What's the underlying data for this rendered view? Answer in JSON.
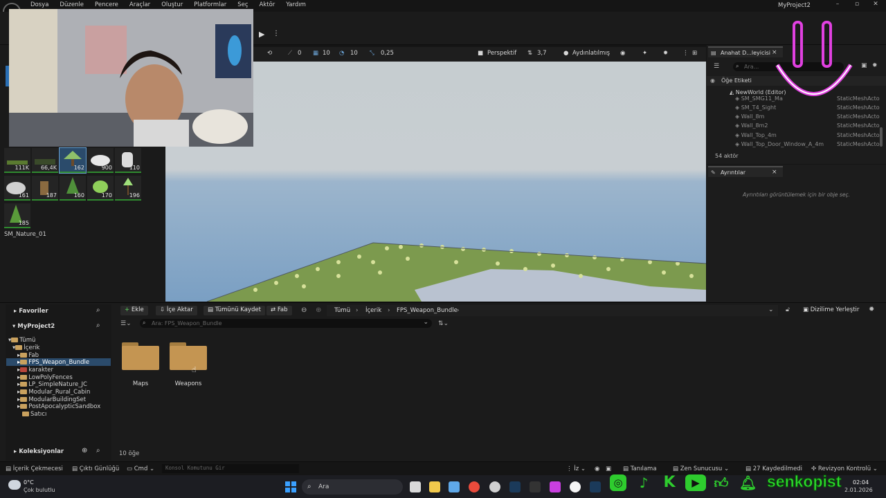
{
  "menu": [
    "Dosya",
    "Düzenle",
    "Pencere",
    "Araçlar",
    "Oluştur",
    "Platformlar",
    "Seç",
    "Aktör",
    "Yardım"
  ],
  "window": {
    "title": "MyProject2",
    "minimize": "–",
    "maximize": "▫",
    "close": "✕"
  },
  "viewport": {
    "toolbar": {
      "rotate": "0",
      "grid": "10",
      "angle": "10",
      "scale": "0,25",
      "view": "Perspektif",
      "speed": "3,7",
      "lit": "Aydınlatılmış"
    }
  },
  "place_actors": {
    "thumbs": [
      "111K",
      "66,4K",
      "162",
      "900",
      "110",
      "161",
      "187",
      "160",
      "170",
      "196",
      "185"
    ],
    "selected_label": "SM_Nature_01"
  },
  "outliner": {
    "tab": "Anahat D...leyicisi",
    "search_placeholder": "Ara...",
    "column_label": "Öğe Etiketi",
    "world": "NewWorld (Editor)",
    "rows": [
      {
        "name": "SM_SMG11_Ma",
        "type": "StaticMeshActo"
      },
      {
        "name": "SM_T4_Sight",
        "type": "StaticMeshActo"
      },
      {
        "name": "Wall_8m",
        "type": "StaticMeshActo"
      },
      {
        "name": "Wall_8m2",
        "type": "StaticMeshActo"
      },
      {
        "name": "Wall_Top_4m",
        "type": "StaticMeshActo"
      },
      {
        "name": "Wall_Top_Door_Window_A_4m",
        "type": "StaticMeshActo"
      }
    ],
    "count": "54 aktör"
  },
  "details": {
    "tab": "Ayrıntılar",
    "empty_message": "Ayrıntıları görüntülemek için bir obje seç."
  },
  "content_browser": {
    "favorites": "Favoriler",
    "project": "MyProject2",
    "tree": [
      "Tümü",
      "İçerik",
      "Fab",
      "FPS_Weapon_Bundle",
      "karakter",
      "LowPolyFences",
      "LP_SimpleNature_JC",
      "Modular_Rural_Cabin",
      "ModularBuildingSet",
      "PostApocalypticSandbox",
      "Satıcı"
    ],
    "collections": "Koleksiyonlar",
    "buttons": {
      "add": "Ekle",
      "import": "İçe Aktar",
      "save_all": "Tümünü Kaydet",
      "fab": "Fab"
    },
    "breadcrumb": [
      "Tümü",
      "İçerik",
      "FPS_Weapon_Bundle"
    ],
    "dock_label": "Dizilime Yerleştir",
    "search_placeholder": "Ara: FPS_Weapon_Bundle",
    "folders": [
      "Maps",
      "Weapons"
    ],
    "item_count": "10 öğe"
  },
  "status_bar": {
    "content_drawer": "İçerik Çekmecesi",
    "output_log": "Çıktı Günlüğü",
    "cmd": "Cmd",
    "console_placeholder": "Konsol Komutunu Gir",
    "trace": "İz",
    "derive": "Tanılama",
    "zen": "Zen Sunucusu",
    "saved": "27 Kaydedilmedi",
    "revision": "Revizyon Kontrolü"
  },
  "taskbar": {
    "weather_temp": "0°C",
    "weather_desc": "Çok bulutlu",
    "search": "Ara",
    "time": "02:04",
    "date": "2.01.2026"
  },
  "overlay": {
    "handle": "senkopist"
  },
  "colors": {
    "accent_green": "#2fdc2f",
    "smile_pink": "#e040e0",
    "selection_blue": "#2b4b6b"
  }
}
